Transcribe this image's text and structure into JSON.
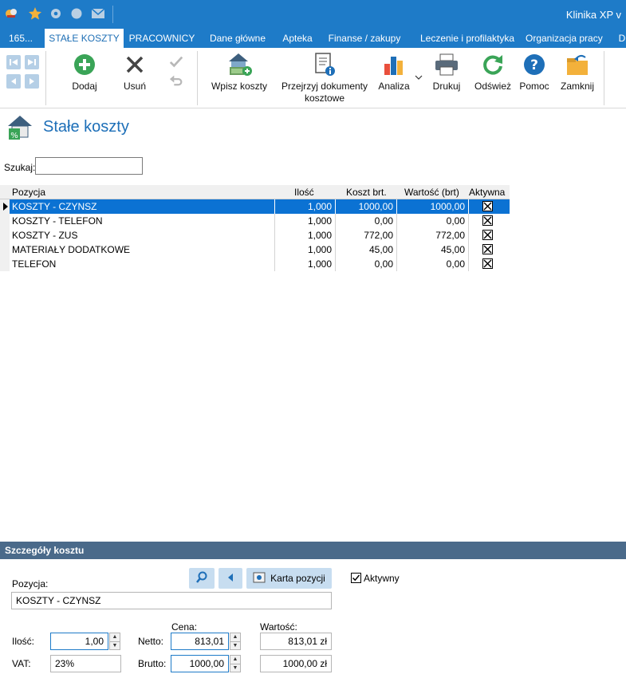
{
  "titlebar": {
    "title": "Klinika XP v"
  },
  "tabs": [
    "165...",
    "STAŁE KOSZTY",
    "PRACOWNICY",
    "Dane główne",
    "Apteka",
    "Finanse / zakupy",
    "Leczenie i profilaktyka",
    "Organizacja pracy",
    "D"
  ],
  "ribbon": {
    "add": "Dodaj",
    "delete": "Usuń",
    "enter_costs": "Wpisz koszty",
    "browse_docs_1": "Przejrzyj dokumenty",
    "browse_docs_2": "kosztowe",
    "analysis": "Analiza",
    "print": "Drukuj",
    "refresh": "Odśwież",
    "help": "Pomoc",
    "close": "Zamknij"
  },
  "page": {
    "title": "Stałe koszty",
    "search_label": "Szukaj:",
    "search_value": ""
  },
  "grid": {
    "headers": [
      "Pozycja",
      "Ilość",
      "Koszt brt.",
      "Wartość (brt)",
      "Aktywna"
    ],
    "rows": [
      [
        "KOSZTY - CZYNSZ",
        "1,000",
        "1000,00",
        "1000,00"
      ],
      [
        "KOSZTY - TELEFON",
        "1,000",
        "0,00",
        "0,00"
      ],
      [
        "KOSZTY - ZUS",
        "1,000",
        "772,00",
        "772,00"
      ],
      [
        "MATERIAŁY DODATKOWE",
        "1,000",
        "45,00",
        "45,00"
      ],
      [
        "TELEFON",
        "1,000",
        "0,00",
        "0,00"
      ]
    ]
  },
  "details": {
    "title": "Szczegóły kosztu",
    "position_label": "Pozycja:",
    "position_value": "KOSZTY - CZYNSZ",
    "card_button": "Karta pozycji",
    "active_label": "Aktywny",
    "qty_label": "Ilość:",
    "qty_value": "1,00",
    "vat_label": "VAT:",
    "vat_value": "23%",
    "price_label": "Cena:",
    "net_label": "Netto:",
    "net_price": "813,01",
    "gross_label": "Brutto:",
    "gross_price": "1000,00",
    "value_label": "Wartość:",
    "net_value": "813,01 zł",
    "gross_value": "1000,00 zł"
  },
  "colors": {
    "accent": "#1e7bc8",
    "selection": "#0b72d3",
    "panel_bar": "#4a6a8a"
  }
}
